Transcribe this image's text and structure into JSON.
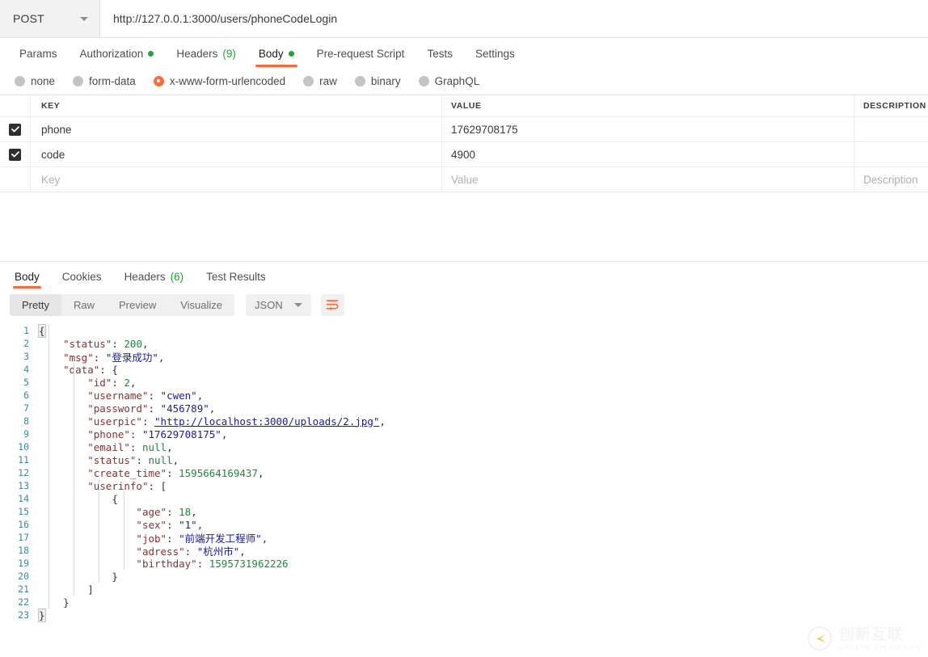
{
  "request": {
    "method": "POST",
    "url": "http://127.0.0.1:3000/users/phoneCodeLogin",
    "tabs": [
      {
        "label": "Params",
        "badge": "",
        "badge_type": "none",
        "active": false
      },
      {
        "label": "Authorization",
        "badge": "●",
        "badge_type": "dot",
        "active": false
      },
      {
        "label": "Headers",
        "badge": "(9)",
        "badge_type": "count",
        "active": false
      },
      {
        "label": "Body",
        "badge": "●",
        "badge_type": "dot",
        "active": true
      },
      {
        "label": "Pre-request Script",
        "badge": "",
        "badge_type": "none",
        "active": false
      },
      {
        "label": "Tests",
        "badge": "",
        "badge_type": "none",
        "active": false
      },
      {
        "label": "Settings",
        "badge": "",
        "badge_type": "none",
        "active": false
      }
    ],
    "body_types": [
      {
        "label": "none",
        "selected": false
      },
      {
        "label": "form-data",
        "selected": false
      },
      {
        "label": "x-www-form-urlencoded",
        "selected": true
      },
      {
        "label": "raw",
        "selected": false
      },
      {
        "label": "binary",
        "selected": false
      },
      {
        "label": "GraphQL",
        "selected": false
      }
    ],
    "table": {
      "headers": [
        "KEY",
        "VALUE",
        "DESCRIPTION"
      ],
      "rows": [
        {
          "checked": true,
          "key": "phone",
          "value": "17629708175",
          "description": ""
        },
        {
          "checked": true,
          "key": "code",
          "value": "4900",
          "description": ""
        }
      ],
      "placeholder_row": {
        "key": "Key",
        "value": "Value",
        "description": "Description"
      }
    }
  },
  "response": {
    "tabs": [
      {
        "label": "Body",
        "badge": "",
        "active": true
      },
      {
        "label": "Cookies",
        "badge": "",
        "active": false
      },
      {
        "label": "Headers",
        "badge": "(6)",
        "active": false
      },
      {
        "label": "Test Results",
        "badge": "",
        "active": false
      }
    ],
    "view_modes": [
      {
        "label": "Pretty",
        "selected": true
      },
      {
        "label": "Raw",
        "selected": false
      },
      {
        "label": "Preview",
        "selected": false
      },
      {
        "label": "Visualize",
        "selected": false
      }
    ],
    "format": "JSON",
    "wrap_icon": "wrap-lines-icon",
    "body_json": {
      "status": 200,
      "msg": "登录成功",
      "data": {
        "id": 2,
        "username": "cwen",
        "password": "456789",
        "userpic": "http://localhost:3000/uploads/2.jpg",
        "phone": "17629708175",
        "email": null,
        "status": null,
        "create_time": 1595664169437,
        "userinfo": [
          {
            "age": 18,
            "sex": "1",
            "job": "前端开发工程师",
            "adress": "杭州市",
            "birthday": 1595731962226
          }
        ]
      }
    },
    "line_count": 23
  },
  "watermark": {
    "cn": "创新互联",
    "en": "CHUANG XIN HU LIAN"
  },
  "colors": {
    "accent": "#ff6c37",
    "green": "#1aa831",
    "key": "#8b2f2f",
    "string": "#1a19a6",
    "number": "#1a8a3c",
    "line_number": "#3b8a96"
  }
}
